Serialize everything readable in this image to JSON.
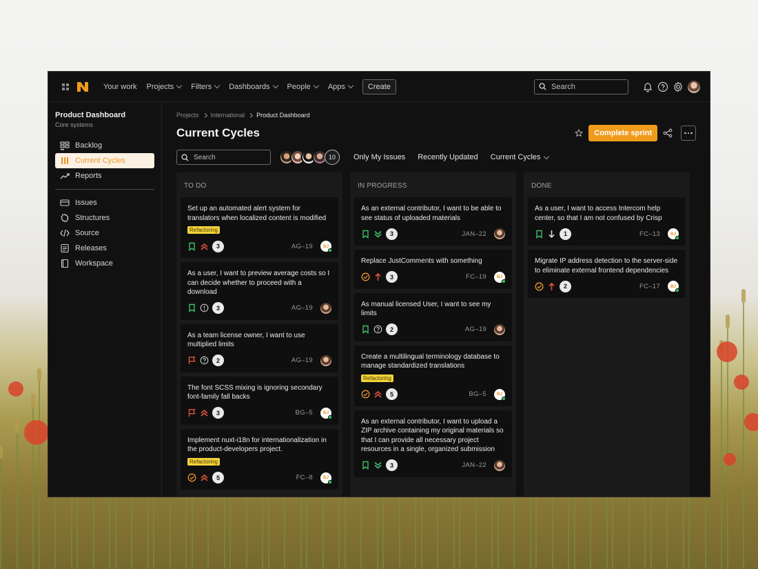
{
  "nav": {
    "items": [
      {
        "label": "Your work",
        "dropdown": false
      },
      {
        "label": "Projects",
        "dropdown": true
      },
      {
        "label": "Filters",
        "dropdown": true
      },
      {
        "label": "Dashboards",
        "dropdown": true
      },
      {
        "label": "People",
        "dropdown": true
      },
      {
        "label": "Apps",
        "dropdown": true
      }
    ],
    "create_label": "Create",
    "search_placeholder": "Search",
    "icons": [
      "bell-icon",
      "help-icon",
      "settings-icon"
    ]
  },
  "sidebar": {
    "project_title": "Product Dashboard",
    "project_subtitle": "Core systems",
    "primary": [
      {
        "label": "Backlog",
        "icon": "backlog-icon",
        "active": false
      },
      {
        "label": "Current Cycles",
        "icon": "cycles-icon",
        "active": true
      },
      {
        "label": "Reports",
        "icon": "reports-icon",
        "active": false
      }
    ],
    "secondary": [
      {
        "label": "Issues",
        "icon": "issues-icon"
      },
      {
        "label": "Structures",
        "icon": "structures-icon"
      },
      {
        "label": "Source",
        "icon": "source-icon"
      },
      {
        "label": "Releases",
        "icon": "releases-icon"
      },
      {
        "label": "Workspace",
        "icon": "workspace-icon"
      }
    ]
  },
  "breadcrumb": [
    "Projects",
    "International",
    "Product Dashboard"
  ],
  "page": {
    "title": "Current Cycles",
    "complete_label": "Complete sprint"
  },
  "filters": {
    "search_placeholder": "Search",
    "avatar_count": "10",
    "items": [
      {
        "label": "Only My Issues",
        "dropdown": false
      },
      {
        "label": "Recently Updated",
        "dropdown": false
      },
      {
        "label": "Current Cycles",
        "dropdown": true
      }
    ]
  },
  "colors": {
    "accent": "#f09b1c",
    "story_green": "#3fbf6a",
    "priority_red": "#e5533c",
    "todo_orange": "#e9962b",
    "tag_yellow": "#f3d33b"
  },
  "board": [
    {
      "title": "TO DO",
      "cards": [
        {
          "title": "Set up an automated alert system for translators when localized content is modified",
          "tag": "Refactoring",
          "type": "bookmark",
          "priority": "highest",
          "points": "3",
          "key": "AG–19",
          "assignee": "initials",
          "initials": "BJ"
        },
        {
          "title": "As a user, I want to preview average costs so I can decide whether to proceed with a download",
          "tag": null,
          "type": "bookmark",
          "priority": "info",
          "points": "3",
          "key": "AG–19",
          "assignee": "face"
        },
        {
          "title": "As a team license owner, I want to use multiplied limits",
          "tag": null,
          "type": "flag",
          "priority": "question",
          "points": "2",
          "key": "AG–19",
          "assignee": "face"
        },
        {
          "title": "The font SCSS mixing is ignoring secondary font-family fall backs",
          "tag": null,
          "type": "flag",
          "priority": "highest",
          "points": "3",
          "key": "BG–5",
          "assignee": "initials",
          "initials": "BJ"
        },
        {
          "title": "Implement nuxt-i18n for internationalization in the product-developers project.",
          "tag": "Refactoring",
          "type": "check",
          "priority": "highest",
          "points": "5",
          "key": "FC–8",
          "assignee": "initials",
          "initials": "BJ"
        }
      ]
    },
    {
      "title": "IN PROGRESS",
      "cards": [
        {
          "title": "As an external contributor, I want to be able to see status of uploaded materials",
          "tag": null,
          "type": "bookmark",
          "priority": "lowest",
          "points": "3",
          "key": "JAN–22",
          "assignee": "face"
        },
        {
          "title": "Replace JustComments with something",
          "tag": null,
          "type": "check",
          "priority": "high",
          "points": "3",
          "key": "FC–19",
          "assignee": "initials",
          "initials": "BJ"
        },
        {
          "title": "As manual licensed User, I want to see my limits",
          "tag": null,
          "type": "bookmark",
          "priority": "question",
          "points": "2",
          "key": "AG–19",
          "assignee": "face"
        },
        {
          "title": "Create a multilingual terminology database to manage standardized translations",
          "tag": "Refactoring",
          "type": "check",
          "priority": "highest",
          "points": "5",
          "key": "BG–5",
          "assignee": "initials",
          "initials": "BJ"
        },
        {
          "title": "As an external contributor, I want to upload a ZIP archive containing my original materials so that I can provide all necessary project resources in a single, organized submission",
          "tag": null,
          "type": "bookmark",
          "priority": "lowest",
          "points": "3",
          "key": "JAN–22",
          "assignee": "face"
        }
      ]
    },
    {
      "title": "DONE",
      "cards": [
        {
          "title": "As a user, I want to access Intercom help center, so that I am not confused by Crisp",
          "tag": null,
          "type": "bookmark",
          "priority": "low",
          "points": "1",
          "key": "FC–13",
          "assignee": "initials",
          "initials": "BJ"
        },
        {
          "title": "Migrate IP address detection to the server-side to eliminate external frontend dependencies",
          "tag": null,
          "type": "check",
          "priority": "high",
          "points": "2",
          "key": "FC–17",
          "assignee": "initials",
          "initials": "BJ"
        }
      ]
    }
  ]
}
